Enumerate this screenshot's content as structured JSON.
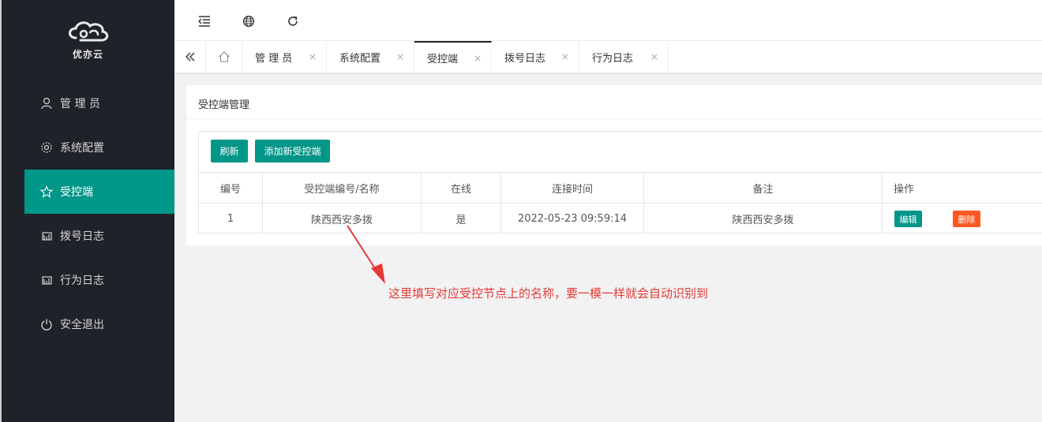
{
  "brand": {
    "logo_text": "优亦云"
  },
  "sidebar": {
    "items": [
      {
        "label": "管 理 员",
        "icon": "user-icon"
      },
      {
        "label": "系统配置",
        "icon": "gear-icon"
      },
      {
        "label": "受控端",
        "icon": "star-icon",
        "active": true
      },
      {
        "label": "拨号日志",
        "icon": "log-icon"
      },
      {
        "label": "行为日志",
        "icon": "log-icon"
      },
      {
        "label": "安全退出",
        "icon": "power-icon"
      }
    ]
  },
  "header": {
    "icons": [
      "menu-fold-icon",
      "globe-icon",
      "refresh-icon"
    ]
  },
  "tabs": [
    {
      "label": "管 理 员"
    },
    {
      "label": "系统配置"
    },
    {
      "label": "受控端",
      "active": true
    },
    {
      "label": "拨号日志"
    },
    {
      "label": "行为日志"
    }
  ],
  "tab_close": "×",
  "card": {
    "title": "受控端管理",
    "refresh_label": "刷新",
    "add_label": "添加新受控端"
  },
  "table": {
    "columns": [
      "编号",
      "受控端编号/名称",
      "在线",
      "连接时间",
      "备注",
      "操作"
    ],
    "rows": [
      {
        "id": "1",
        "name": "陕西西安多拨",
        "online": "是",
        "connect_time": "2022-05-23 09:59:14",
        "remark": "陕西西安多拨",
        "edit_label": "编辑",
        "delete_label": "删除"
      }
    ]
  },
  "annotation": {
    "text": "这里填写对应受控节点上的名称，要一模一样就会自动识别到"
  },
  "colors": {
    "sidebar": "#20222a",
    "accent": "#009688",
    "danger": "#ff5722",
    "annotation": "#e53935"
  }
}
